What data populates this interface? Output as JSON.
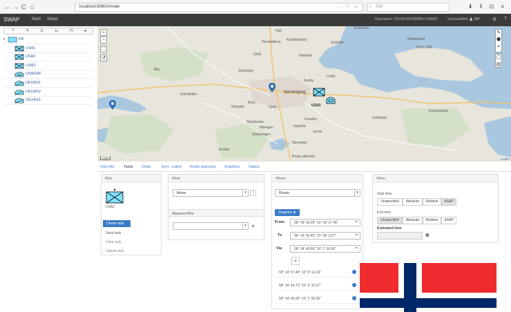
{
  "browser": {
    "url": "localhost:8080/#/main",
    "search_placeholder": "Sök",
    "nav_back": "←",
    "nav_forward": "→",
    "nav_reload": "C",
    "nav_home": "⌂",
    "url_actions": "··· ♡ ☆",
    "right_icons": "⬇ ⫴ ⊡ ≡"
  },
  "header": {
    "logo": "SWAP",
    "menu": [
      "Main",
      "Setup"
    ],
    "operation": "Operation: CEGM-00189686-143843",
    "classification": "Unclassified",
    "user": "SM"
  },
  "sidebar": {
    "toolbar": [
      "×",
      "✎",
      "⊏",
      "⊔",
      "⊓",
      "▸"
    ],
    "items": [
      {
        "label": "FR",
        "icon": "friendly-hq-icon"
      },
      {
        "label": "USA1",
        "icon": "infantry-unit-icon"
      },
      {
        "label": "USA2",
        "icon": "infantry-unit-icon"
      },
      {
        "label": "USA3",
        "icon": "infantry-unit-icon"
      },
      {
        "label": "USAGRF",
        "icon": "armor-unit-icon"
      },
      {
        "label": "UKUAS1",
        "icon": "recon-unit-icon"
      },
      {
        "label": "UKUAS2",
        "icon": "recon-unit-icon"
      },
      {
        "label": "SEUAS3",
        "icon": "recon-unit-icon"
      }
    ]
  },
  "map": {
    "labels": [
      "Kvarsebo",
      "Hult",
      "Händelö",
      "Herstadberg",
      "Kardinalstorp",
      "Gulsäter",
      "Lindö",
      "Eneby",
      "Vikbolandet",
      "Östra Såll",
      "Getå",
      "Grytsberg",
      "Norrköping",
      "Borg",
      "Ljura",
      "Klingsbo",
      "Skärblacka",
      "Smedby",
      "Ingelsta",
      "Vilbergen",
      "Skarphagen",
      "Navestad",
      "Krokek",
      "Åby",
      "Kolmården",
      "Borgs villastad",
      "Svärtinge",
      "Jursla",
      "Konungsund"
    ],
    "unit_label": "USA3",
    "attribution": "Leaflet",
    "scale": "1 km"
  },
  "tabs": [
    "Unit info",
    "Tasks",
    "Order",
    "Sync. matrix",
    "Route planning",
    "Graphics",
    "Status"
  ],
  "active_tab": "Tasks",
  "who": {
    "title": "Who",
    "unit": "USA2",
    "buttons": {
      "create": "Create task",
      "send": "Send task",
      "clear": "Clear task",
      "update": "Update task"
    }
  },
  "what": {
    "title": "What",
    "task_value": "Move",
    "attached_label": "Attached Who",
    "attached_value": ""
  },
  "where": {
    "title": "Where",
    "type_value": "Route",
    "graphics_btn": "Graphics ⊕",
    "from_label": "From",
    "from_value": "58° 36' 03.06\" 15° 18' 27.45\"",
    "to_label": "To",
    "to_value": "58° 34' 43.40\" 15° 58' 9.57\"",
    "via_label": "Via",
    "via_value": "58° 34' 45.66\" 16° 1' 56.90\"",
    "add_btn": "+",
    "waypoints": [
      "58° 34' 57.48\" 16° 8' 12.24\"",
      "58° 34' 43.73\" 16° 6' 32.57\"",
      "58° 34' 46.00\" 16° 1' 56.96\""
    ]
  },
  "when": {
    "title": "When",
    "start_label": "Start time",
    "end_label": "End time",
    "segments": [
      "Unspecified",
      "Absolute",
      "Relative",
      "ASAP"
    ],
    "start_selected": "ASAP",
    "end_selected": "Unspecified",
    "estimated_label": "Estimated time"
  },
  "colors": {
    "accent": "#3a7bc8",
    "header": "#3a3a3a",
    "flag_red": "#ef2b2d",
    "flag_blue": "#002868"
  }
}
